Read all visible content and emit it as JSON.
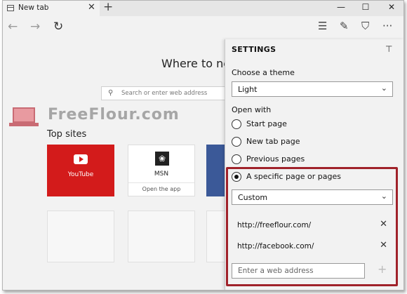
{
  "tab": {
    "title": "New tab"
  },
  "toolbar": {
    "new_tab": "+",
    "minimize": "—",
    "maximize": "☐",
    "close": "✕"
  },
  "nav": {
    "back": "←",
    "forward": "→",
    "refresh": "↻",
    "hub": "☰",
    "note": "✎",
    "share": "⛉",
    "more": "···"
  },
  "page": {
    "heading": "Where to next?",
    "search_placeholder": "Search or enter web address",
    "watermark": "FreeFlour.com",
    "top_sites_label": "Top sites",
    "tiles": [
      {
        "label": "YouTube",
        "color": "#d31b1b"
      },
      {
        "label": "MSN",
        "sub": "Open the app"
      }
    ]
  },
  "settings": {
    "title": "SETTINGS",
    "theme_label": "Choose a theme",
    "theme_value": "Light",
    "open_with_label": "Open with",
    "options": [
      "Start page",
      "New tab page",
      "Previous pages",
      "A specific page or pages"
    ],
    "selected_option": "A specific page or pages",
    "pages_select": "Custom",
    "pages": [
      "http://freeflour.com/",
      "http://facebook.com/"
    ],
    "add_placeholder": "Enter a web address",
    "highlight_color": "#a0222a"
  }
}
